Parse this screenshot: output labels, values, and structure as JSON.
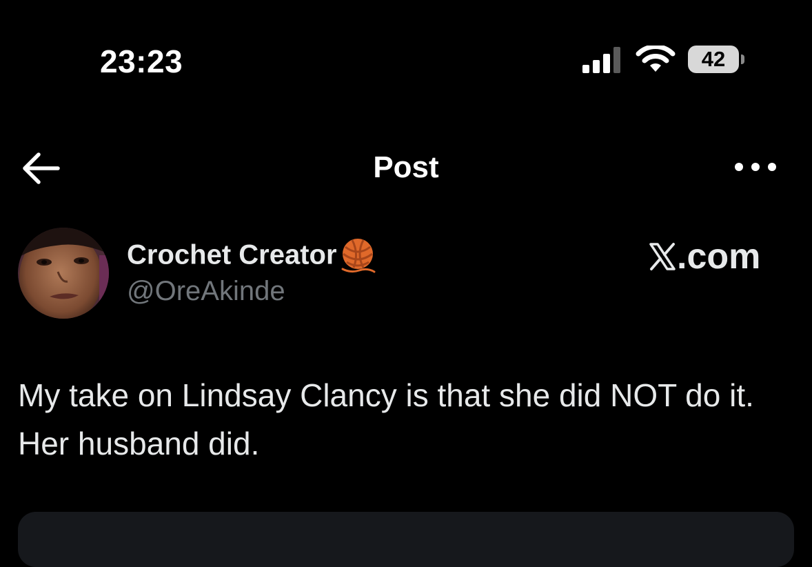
{
  "status_bar": {
    "time": "23:23",
    "battery_level": "42",
    "signal_bars": 3,
    "signal_icon": "cellular-signal-icon",
    "wifi_icon": "wifi-icon",
    "battery_icon": "battery-icon"
  },
  "nav": {
    "title": "Post",
    "back_icon": "arrow-left-icon",
    "more_icon": "more-horizontal-icon"
  },
  "post": {
    "author_name": "Crochet Creator",
    "author_emoji": "yarn-emoji",
    "handle": "@OreAkinde",
    "source_label": ".com",
    "source_logo": "x-logo-icon",
    "text": "My take on Lindsay Clancy is that she did NOT do it. Her husband did."
  },
  "colors": {
    "background": "#000000",
    "primary_text": "#e7e9ea",
    "secondary_text": "#71767b",
    "card_background": "#16181c",
    "yarn": "#e0692a"
  }
}
